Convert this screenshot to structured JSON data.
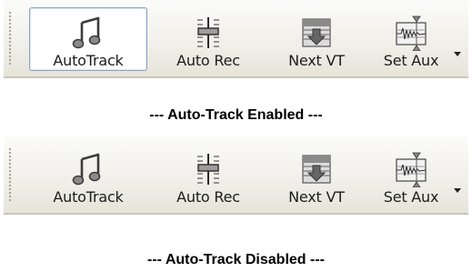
{
  "panels": [
    {
      "caption": "--- Auto-Track Enabled ---",
      "buttons": [
        {
          "label": "AutoTrack",
          "icon": "music-note-icon",
          "pressed": true
        },
        {
          "label": "Auto Rec",
          "icon": "fader-slider-icon"
        },
        {
          "label": "Next VT",
          "icon": "next-voice-track-icon"
        },
        {
          "label": "Set Aux",
          "icon": "set-aux-waveform-icon"
        }
      ],
      "overflow_icon": "chevron-down-icon"
    },
    {
      "caption": "--- Auto-Track Disabled ---",
      "buttons": [
        {
          "label": "AutoTrack",
          "icon": "music-note-icon",
          "pressed": false
        },
        {
          "label": "Auto Rec",
          "icon": "fader-slider-icon"
        },
        {
          "label": "Next VT",
          "icon": "next-voice-track-icon"
        },
        {
          "label": "Set Aux",
          "icon": "set-aux-waveform-icon"
        }
      ],
      "overflow_icon": "chevron-down-icon"
    }
  ],
  "colors": {
    "pressed_border": "#8aa6c6",
    "toolbar_bottom": "#c9c6b8"
  }
}
